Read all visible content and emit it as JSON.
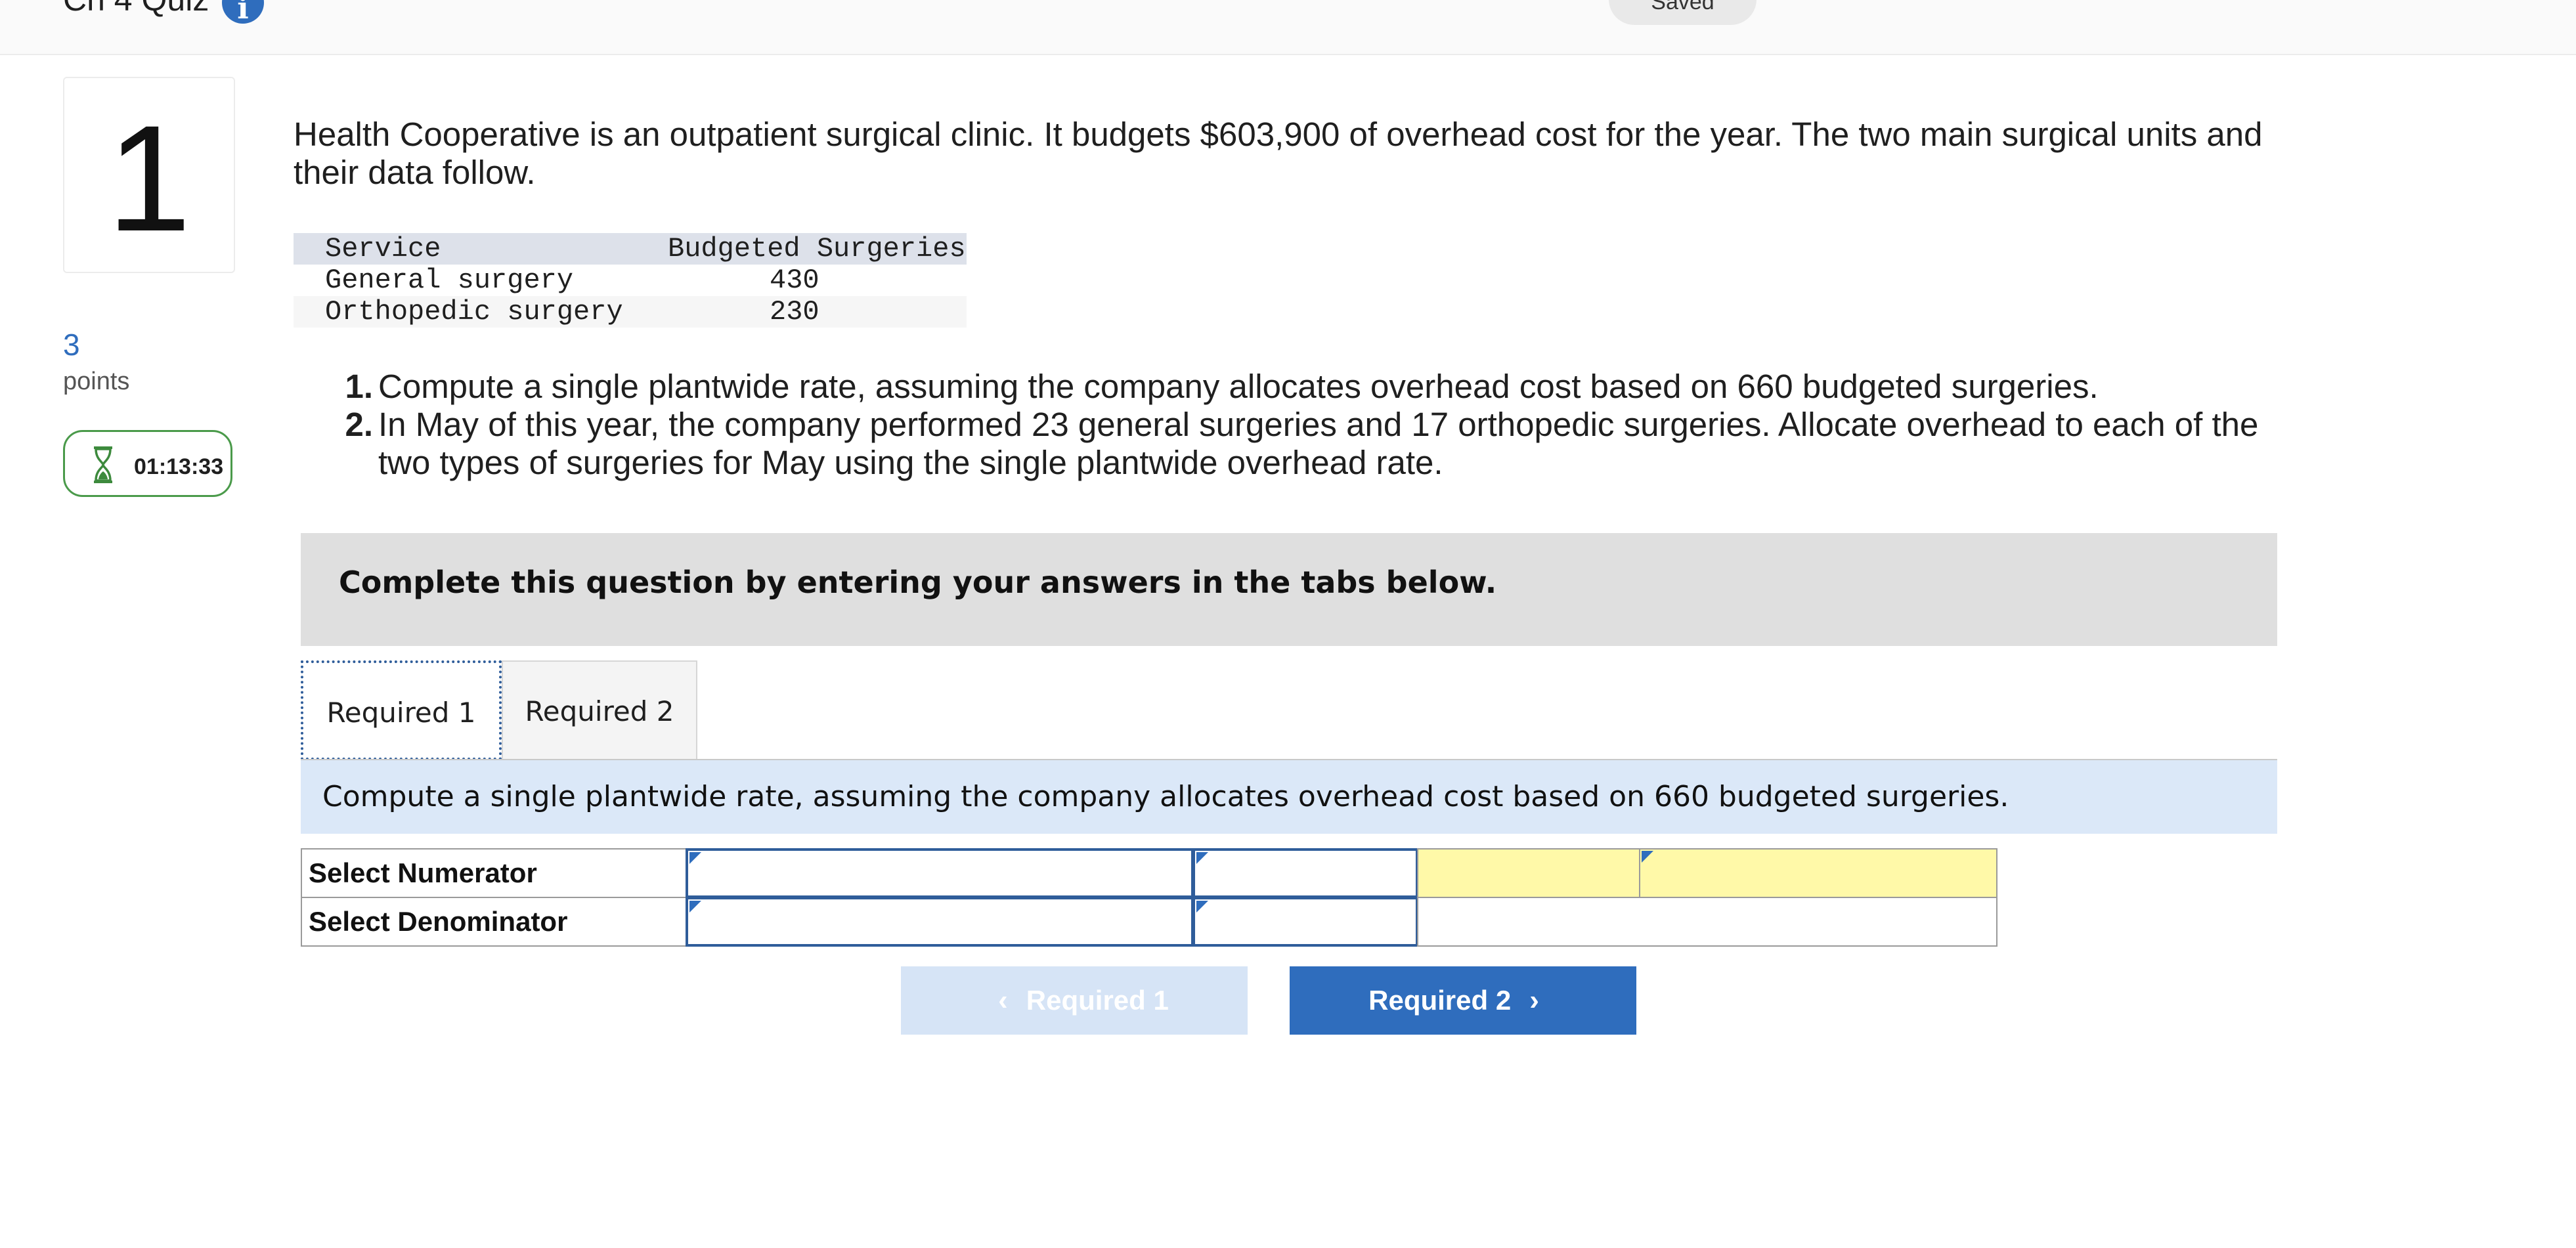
{
  "header": {
    "quiz_title": "Ch 4 Quiz",
    "info_icon": "i",
    "saved_label": "Saved"
  },
  "question": {
    "number": "1",
    "points_value": "3",
    "points_label": "points",
    "timer": "01:13:33",
    "intro": "Health Cooperative is an outpatient surgical clinic. It budgets $603,900 of overhead cost for the year. The two main surgical units and their data follow.",
    "table": {
      "headers": [
        "Service",
        "Budgeted Surgeries"
      ],
      "rows": [
        [
          "General surgery",
          "430"
        ],
        [
          "Orthopedic surgery",
          "230"
        ]
      ]
    },
    "requirements": [
      {
        "num": "1.",
        "text": "Compute a single plantwide rate, assuming the company allocates overhead cost based on 660 budgeted surgeries."
      },
      {
        "num": "2.",
        "text": "In May of this year, the company performed 23 general surgeries and 17 orthopedic surgeries. Allocate overhead to each of the two types of surgeries for May using the single plantwide overhead rate."
      }
    ]
  },
  "instructions": "Complete this question by entering your answers in the tabs below.",
  "tabs": [
    {
      "label": "Required 1",
      "active": true
    },
    {
      "label": "Required 2",
      "active": false
    }
  ],
  "prompt": "Compute a single plantwide rate, assuming the company allocates overhead cost based on 660 budgeted surgeries.",
  "answer_grid": {
    "rows": [
      "Select Numerator",
      "Select Denominator"
    ]
  },
  "nav": {
    "prev_label": "Required 1",
    "next_label": "Required 2"
  },
  "colors": {
    "accent": "#2f6dbd",
    "highlight": "#fff9a8",
    "prompt_band": "#dbe8f8",
    "timer_border": "#4a9a4a"
  }
}
